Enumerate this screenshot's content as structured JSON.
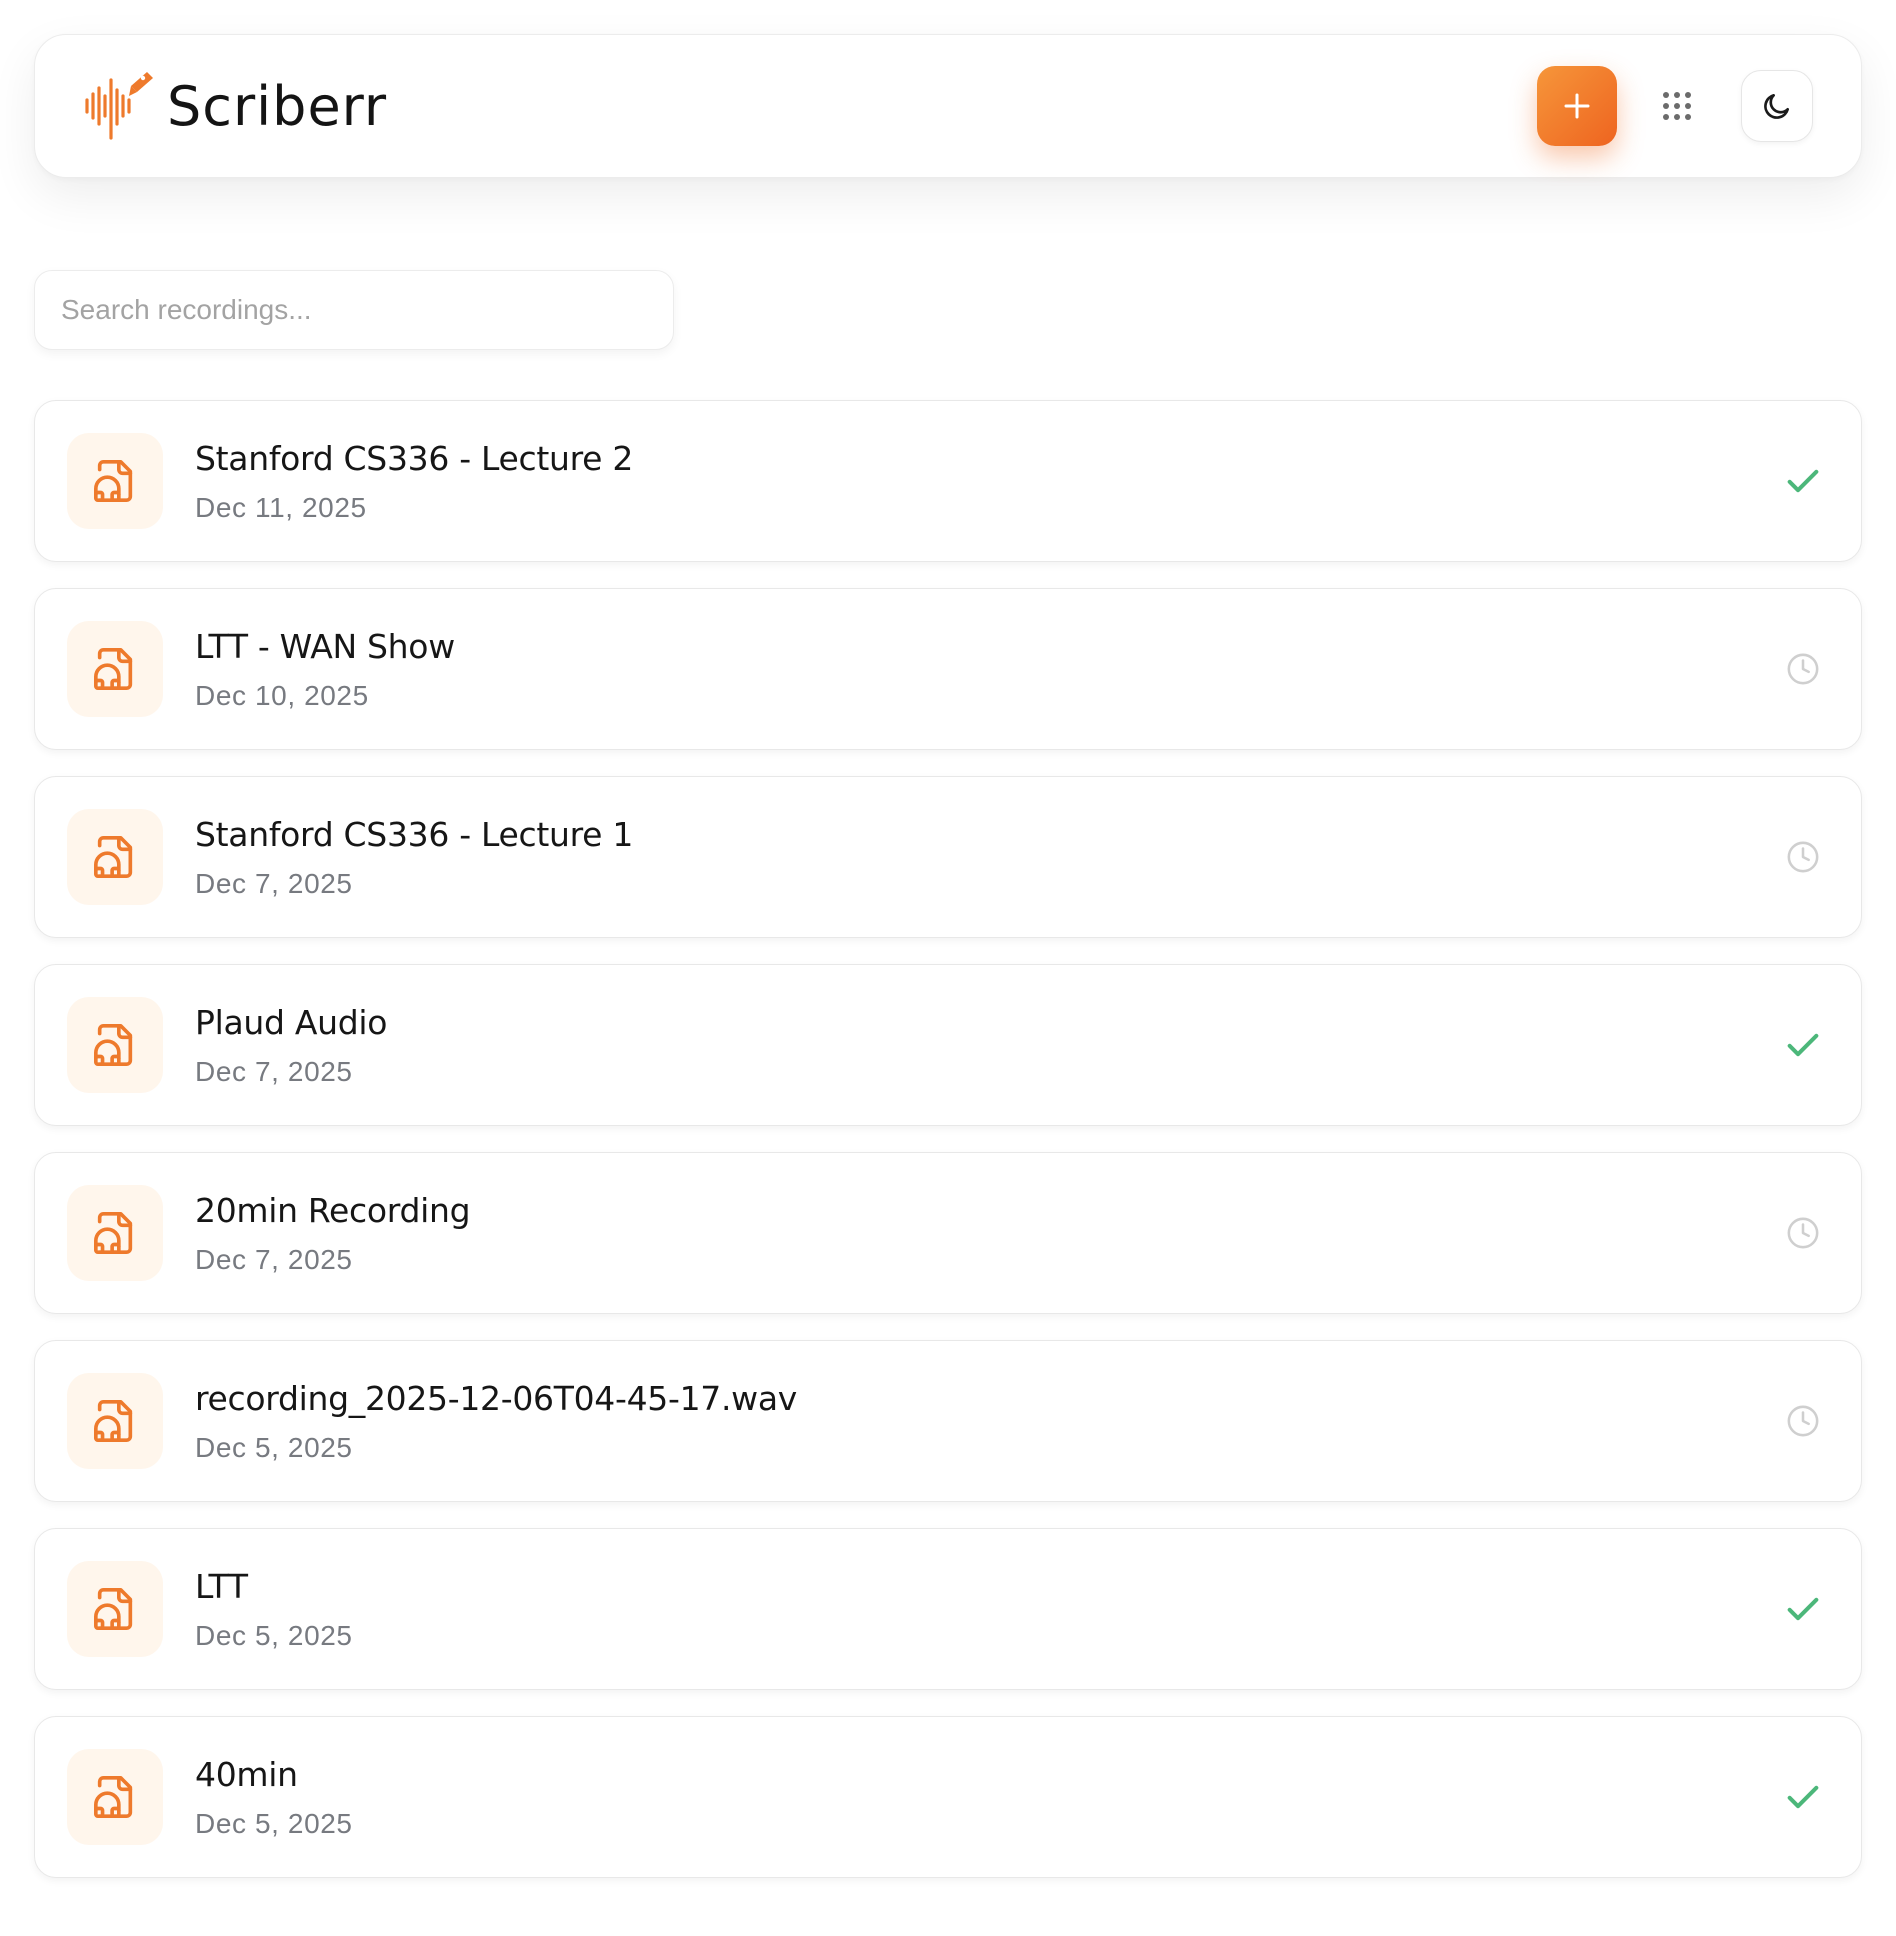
{
  "brand": {
    "name": "Scriberr",
    "accent": "#ee7a2c"
  },
  "header": {
    "add_label": "+",
    "add_icon": "plus-icon",
    "apps_icon": "grid-dots-icon",
    "theme_icon": "moon-icon"
  },
  "search": {
    "placeholder": "Search recordings...",
    "value": ""
  },
  "colors": {
    "done": "#4cb77a",
    "pending": "#cfcfcf"
  },
  "recordings": [
    {
      "title": "Stanford CS336 - Lecture 2",
      "date": "Dec 11, 2025",
      "status": "completed"
    },
    {
      "title": "LTT - WAN Show",
      "date": "Dec 10, 2025",
      "status": "pending"
    },
    {
      "title": "Stanford CS336 - Lecture 1",
      "date": "Dec 7, 2025",
      "status": "pending"
    },
    {
      "title": "Plaud Audio",
      "date": "Dec 7, 2025",
      "status": "completed"
    },
    {
      "title": "20min Recording",
      "date": "Dec 7, 2025",
      "status": "pending"
    },
    {
      "title": "recording_2025-12-06T04-45-17.wav",
      "date": "Dec 5, 2025",
      "status": "pending"
    },
    {
      "title": "LTT",
      "date": "Dec 5, 2025",
      "status": "completed"
    },
    {
      "title": "40min",
      "date": "Dec 5, 2025",
      "status": "completed"
    }
  ]
}
